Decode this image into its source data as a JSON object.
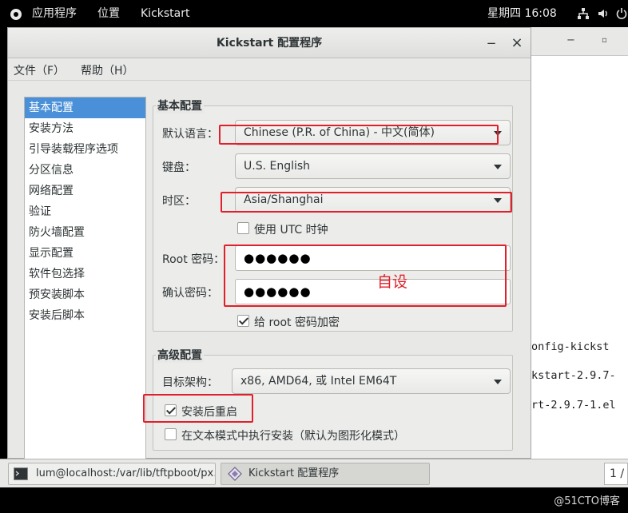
{
  "topbar": {
    "apps_menu": "应用程序",
    "places_menu": "位置",
    "active_app": "Kickstart",
    "clock": "星期四 16:08"
  },
  "background_terminal": {
    "lines": [
      "onfig-kickst",
      "kstart-2.9.7-",
      "rt-2.9.7-1.el"
    ]
  },
  "window": {
    "title": "Kickstart 配置程序",
    "close_glyph": "×",
    "minimize_glyph": "−"
  },
  "menubar": {
    "file": "文件（F）",
    "help": "帮助（H）"
  },
  "sidebar": {
    "items": [
      {
        "label": "基本配置"
      },
      {
        "label": "安装方法"
      },
      {
        "label": "引导装载程序选项"
      },
      {
        "label": "分区信息"
      },
      {
        "label": "网络配置"
      },
      {
        "label": "验证"
      },
      {
        "label": "防火墙配置"
      },
      {
        "label": "显示配置"
      },
      {
        "label": "软件包选择"
      },
      {
        "label": "预安装脚本"
      },
      {
        "label": "安装后脚本"
      }
    ],
    "selected_index": 0
  },
  "basic": {
    "section_title": "基本配置",
    "language_label": "默认语言：",
    "language_value": "Chinese (P.R. of China) - 中文(简体)",
    "keyboard_label": "键盘：",
    "keyboard_value": "U.S. English",
    "timezone_label": "时区：",
    "timezone_value": "Asia/Shanghai",
    "utc_label": "使用  UTC 时钟",
    "utc_checked": false,
    "root_pw_label": "Root 密码：",
    "root_pw_value": "●●●●●●",
    "confirm_pw_label": "确认密码：",
    "confirm_pw_value": "●●●●●●",
    "encrypt_label": "给  root 密码加密",
    "encrypt_checked": true
  },
  "annotation": {
    "text": "自设",
    "color": "#e0202a"
  },
  "advanced": {
    "section_title": "高级配置",
    "arch_label": "目标架构：",
    "arch_value": "x86, AMD64, 或  Intel EM64T",
    "reboot_label": "安装后重启",
    "reboot_checked": true,
    "textmode_label": "在文本模式中执行安装（默认为图形化模式）",
    "textmode_checked": false
  },
  "taskbar": {
    "tasks": [
      {
        "label": "lum@localhost:/var/lib/tftpboot/px…",
        "icon": "terminal-icon"
      },
      {
        "label": "Kickstart 配置程序",
        "icon": "kickstart-icon"
      }
    ],
    "pager": "1 /"
  },
  "watermark": "@51CTO博客",
  "colors": {
    "selection": "#4a90d9",
    "annotation_red": "#e0202a",
    "window_bg": "#e8e8e7"
  }
}
